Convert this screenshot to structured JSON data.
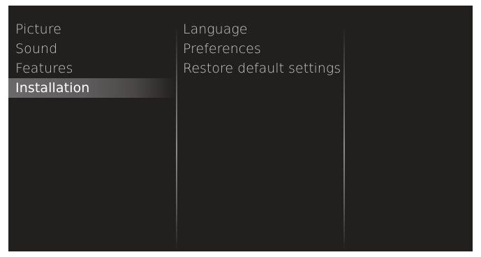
{
  "menu": {
    "items": [
      {
        "label": "Picture"
      },
      {
        "label": "Sound"
      },
      {
        "label": "Features"
      },
      {
        "label": "Installation"
      }
    ],
    "selected_index": 3
  },
  "submenu": {
    "items": [
      {
        "label": "Language"
      },
      {
        "label": "Preferences"
      },
      {
        "label": "Restore default settings"
      }
    ]
  }
}
